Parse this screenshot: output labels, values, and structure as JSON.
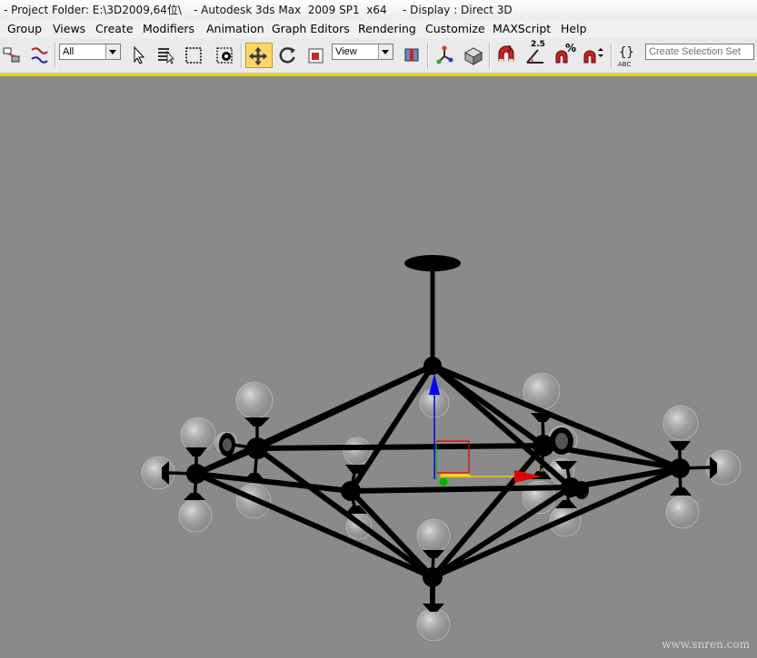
{
  "window": {
    "project_folder": "- Project Folder: E:\\3D2009,64位\\",
    "app_title": "- Autodesk 3ds Max  2009 SP1  x64",
    "display": "- Display : Direct 3D"
  },
  "menu": [
    "Group",
    "Views",
    "Create",
    "Modifiers",
    "Animation",
    "Graph Editors",
    "Rendering",
    "Customize",
    "MAXScript",
    "Help"
  ],
  "toolbar": {
    "selection_filter": "All",
    "reference_coord": "View",
    "snap_angle_label": "2.5",
    "percent_snap_label": "%",
    "named_selection_placeholder": "Create Selection Set",
    "active_tool": "move-icon"
  },
  "colors": {
    "accent": "#e4d200",
    "viewport_bg": "#8a8a8a",
    "gizmo_x": "#e00000",
    "gizmo_y": "#00b400",
    "gizmo_z": "#0000ff"
  },
  "watermark": "www.snren.com"
}
